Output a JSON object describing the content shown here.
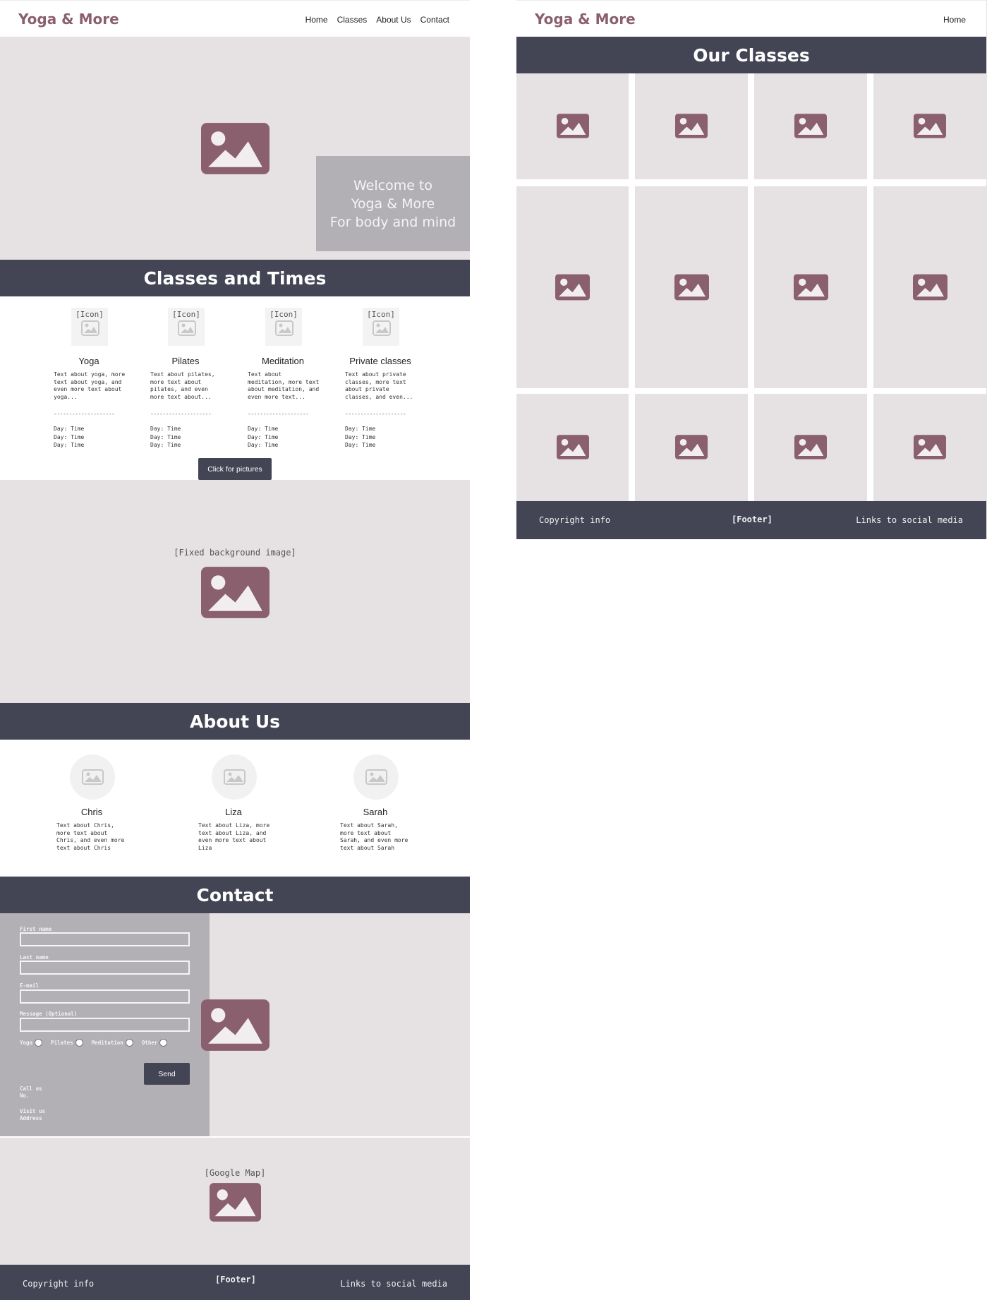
{
  "colors": {
    "brand": "#8a5f6e",
    "dark": "#434454",
    "placeholder": "#e6e2e4",
    "panel": "#b2b0b5"
  },
  "home_page": {
    "logo": "Yoga & More",
    "nav": [
      "Home",
      "Classes",
      "About Us",
      "Contact"
    ],
    "hero": {
      "image_icon": "image-icon",
      "welcome_lines": [
        "Welcome to",
        "Yoga & More",
        "For body and mind"
      ]
    },
    "classes_section": {
      "title": "Classes and Times",
      "items": [
        {
          "icon_tag": "[Icon]",
          "title": "Yoga",
          "text": "Text about yoga, more\ntext about yoga, and\neven more text about\nyoga...",
          "divider": "--------------------",
          "times": "Day: Time\nDay: Time\nDay: Time"
        },
        {
          "icon_tag": "[Icon]",
          "title": "Pilates",
          "text": "Text about pilates,\nmore text about\npilates, and even\nmore text about...",
          "divider": "--------------------",
          "times": "Day: Time\nDay: Time\nDay: Time"
        },
        {
          "icon_tag": "[Icon]",
          "title": "Meditation",
          "text": "Text about\nmeditation, more text\nabout meditation, and\neven more text...",
          "divider": "--------------------",
          "times": "Day: Time\nDay: Time\nDay: Time"
        },
        {
          "icon_tag": "[Icon]",
          "title": "Private classes",
          "text": "Text about private\nclasses, more text\nabout private\nclasses, and even...",
          "divider": "--------------------",
          "times": "Day: Time\nDay: Time\nDay: Time"
        }
      ],
      "button": "Click for pictures"
    },
    "fixed_background": {
      "tag": "[Fixed background image]"
    },
    "about_section": {
      "title": "About Us",
      "people": [
        {
          "name": "Chris",
          "text": "Text about Chris,\nmore text about\nChris, and even more\ntext about Chris"
        },
        {
          "name": "Liza",
          "text": "Text about Liza, more\ntext about Liza, and\neven more text about\nLiza"
        },
        {
          "name": "Sarah",
          "text": "Text about Sarah,\nmore text about\nSarah, and even more\ntext about Sarah"
        }
      ]
    },
    "contact_section": {
      "title": "Contact",
      "fields": [
        "First name",
        "Last name",
        "E-mail",
        "Message (Optional)"
      ],
      "radio_options": [
        "Yoga",
        "Pilates",
        "Meditation",
        "Other"
      ],
      "send_button": "Send",
      "call": "Call us\nNo.",
      "visit": "Visit us\nAddress"
    },
    "map": {
      "tag": "[Google Map]"
    },
    "footer": {
      "left": "Copyright info",
      "center": "[Footer]",
      "right": "Links to social media"
    }
  },
  "classes_page": {
    "logo": "Yoga & More",
    "nav": [
      "Home"
    ],
    "title": "Our Classes",
    "gallery_tile_count": 12,
    "footer": {
      "left": "Copyright info",
      "center": "[Footer]",
      "right": "Links to social media"
    }
  }
}
